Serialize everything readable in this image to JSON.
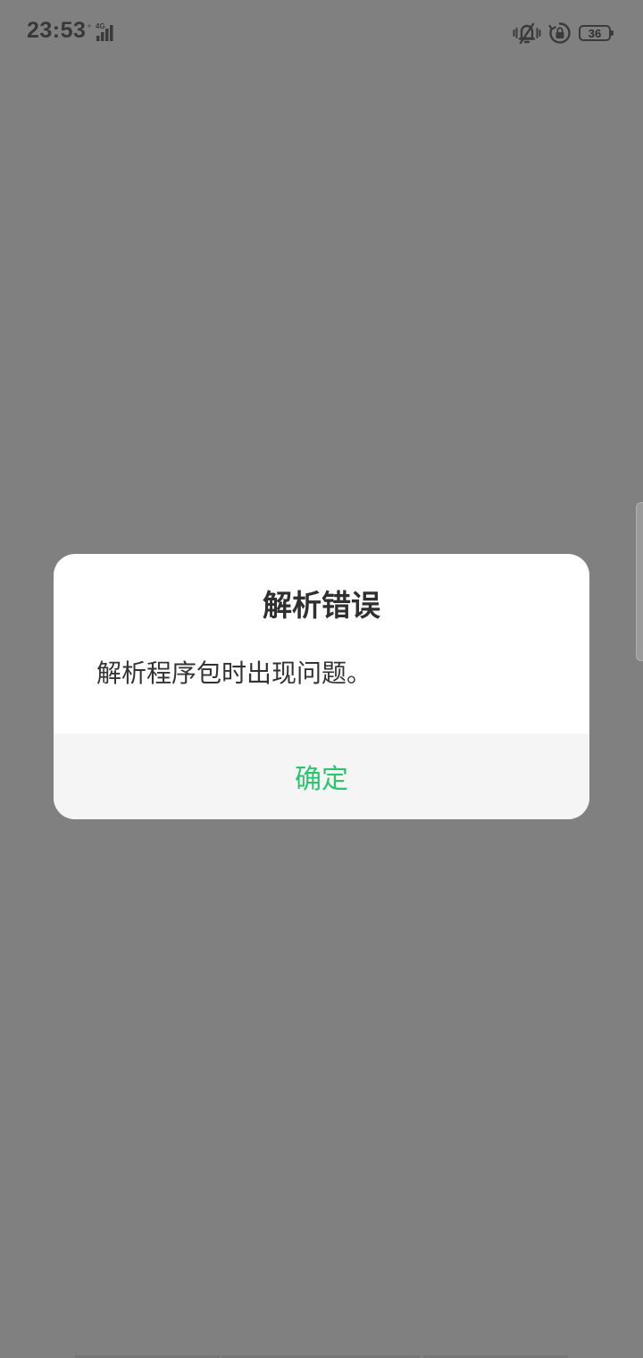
{
  "status_bar": {
    "time": "23:53",
    "network": "4G",
    "battery": "36"
  },
  "dialog": {
    "title": "解析错误",
    "message": "解析程序包时出现问题。",
    "confirm_label": "确定"
  },
  "colors": {
    "overlay": "#808080",
    "dialog_bg": "#ffffff",
    "footer_bg": "#f5f5f5",
    "accent": "#2cc46f"
  }
}
